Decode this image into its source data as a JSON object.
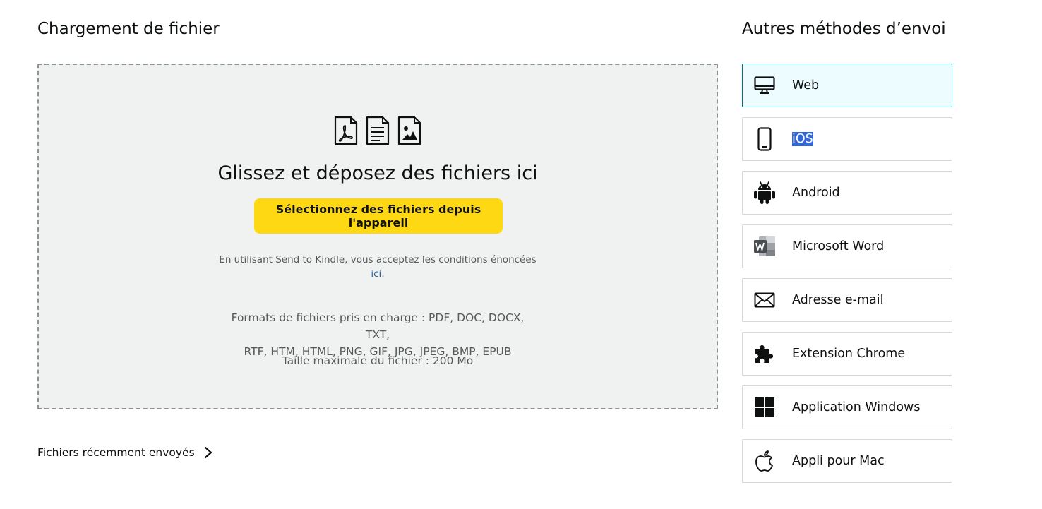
{
  "upload": {
    "title": "Chargement de fichier",
    "drop_heading": "Glissez et déposez des fichiers ici",
    "select_button": "Sélectionnez des fichiers depuis l'appareil",
    "terms_text": "En utilisant Send to Kindle, vous acceptez les conditions énoncées",
    "terms_link": "ici",
    "terms_suffix": ".",
    "formats_line1": "Formats de fichiers pris en charge : PDF, DOC, DOCX, TXT,",
    "formats_line2": "RTF, HTM, HTML, PNG, GIF, JPG, JPEG, BMP, EPUB",
    "max_size": "Taille maximale du fichier : 200 Mo",
    "file_icons": [
      "pdf-file-icon",
      "text-file-icon",
      "image-file-icon"
    ]
  },
  "recent": {
    "label": "Fichiers récemment envoyés",
    "icon": "chevron-right-icon"
  },
  "other_methods": {
    "title": "Autres méthodes d’envoi",
    "items": [
      {
        "label": "Web",
        "icon": "desktop-icon",
        "selected": true
      },
      {
        "label": "iOS",
        "icon": "phone-icon",
        "text_highlighted": true
      },
      {
        "label": "Android",
        "icon": "android-icon"
      },
      {
        "label": "Microsoft Word",
        "icon": "word-icon"
      },
      {
        "label": "Adresse e-mail",
        "icon": "envelope-icon"
      },
      {
        "label": "Extension Chrome",
        "icon": "puzzle-icon"
      },
      {
        "label": "Application Windows",
        "icon": "windows-icon"
      },
      {
        "label": "Appli pour Mac",
        "icon": "apple-icon"
      }
    ]
  },
  "colors": {
    "button_yellow": "#ffd814",
    "dropzone_bg": "#f0f2f2",
    "selected_bg": "#edfdff",
    "selected_border": "#007185",
    "link": "#2162a1",
    "text_selection": "#3367d6"
  }
}
